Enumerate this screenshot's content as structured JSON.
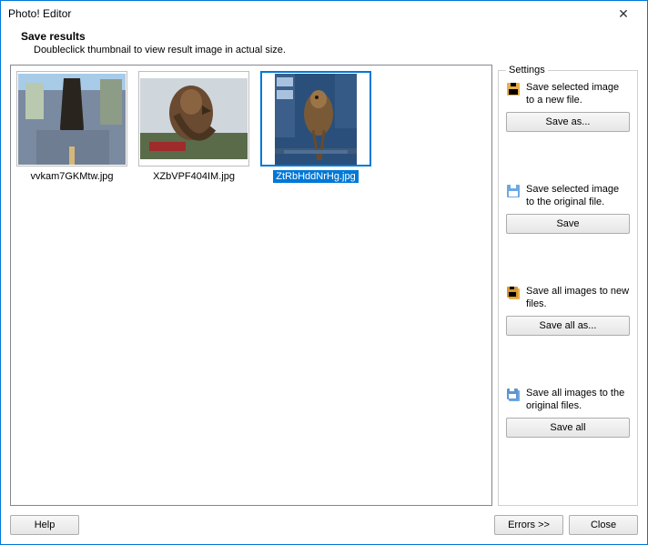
{
  "window": {
    "title": "Photo! Editor"
  },
  "header": {
    "title": "Save results",
    "subtitle": "Doubleclick thumbnail to view result image in actual size."
  },
  "thumbnails": {
    "items": [
      {
        "label": "vvkam7GKMtw.jpg",
        "selected": false
      },
      {
        "label": "XZbVPF404IM.jpg",
        "selected": false
      },
      {
        "label": "ZtRbHddNrHg.jpg",
        "selected": true
      }
    ]
  },
  "settings": {
    "legend": "Settings",
    "blocks": [
      {
        "text": "Save selected image to a new file.",
        "button": "Save as..."
      },
      {
        "text": "Save selected image to the original file.",
        "button": "Save"
      },
      {
        "text": "Save all images to new files.",
        "button": "Save all as..."
      },
      {
        "text": "Save all images to the original files.",
        "button": "Save all"
      }
    ]
  },
  "footer": {
    "help": "Help",
    "errors": "Errors >>",
    "close": "Close"
  }
}
